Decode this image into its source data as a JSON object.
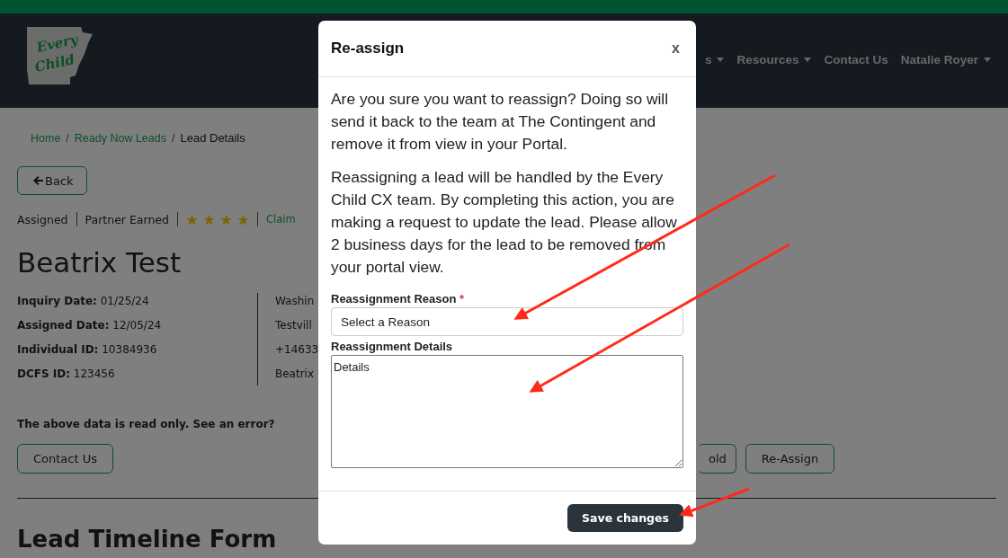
{
  "logo": {
    "line1": "Every",
    "line2": "Child"
  },
  "nav": [
    {
      "label": "s",
      "dropdown": true
    },
    {
      "label": "Resources",
      "dropdown": true
    },
    {
      "label": "Contact Us",
      "dropdown": false
    },
    {
      "label": "Natalie Royer",
      "dropdown": true
    }
  ],
  "breadcrumb": [
    {
      "label": "Home",
      "link": true
    },
    {
      "separator": "/",
      "label": "Ready Now Leads",
      "link": true
    },
    {
      "separator": "/",
      "label": "Lead Details",
      "link": false
    }
  ],
  "back_button": "Back",
  "status_line": {
    "status": "Assigned",
    "tier": "Partner Earned",
    "stars": 4,
    "link": "Claim"
  },
  "lead_name": "Beatrix Test",
  "details_left": [
    {
      "label": "Inquiry Date:",
      "value": "01/25/24"
    },
    {
      "label": "Assigned Date:",
      "value": "12/05/24"
    },
    {
      "label": "Individual ID:",
      "value": "10384936"
    },
    {
      "label": "DCFS ID:",
      "value": "123456"
    }
  ],
  "details_right": [
    "Washin",
    "Testvill",
    "+14633",
    "Beatrix"
  ],
  "read_only_note": "The above data is read only. See an error?",
  "contact_button": "Contact Us",
  "action_buttons": [
    "old",
    "Re-Assign"
  ],
  "section_heading": "Lead Timeline Form",
  "modal": {
    "title": "Re-assign",
    "close": "x",
    "paragraphs": [
      "Are you sure you want to reassign? Doing so will send it back to the team at The Contingent and remove it from view in your Portal.",
      "Reassigning a lead will be handled by the Every Child CX team. By completing this action, you are making a request to update the lead. Please allow 2 business days for the lead to be removed from your portal view."
    ],
    "reason_label": "Reassignment Reason",
    "required_mark": "*",
    "reason_value": "Select a Reason",
    "details_label": "Reassignment Details",
    "details_placeholder": "Details",
    "save_button": "Save changes"
  }
}
